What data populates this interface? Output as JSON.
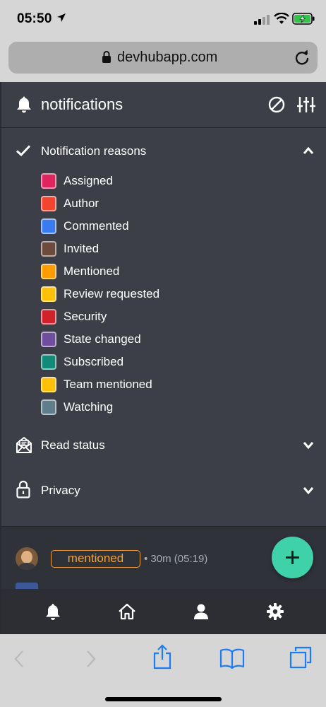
{
  "status_bar": {
    "time": "05:50"
  },
  "browser": {
    "url": "devhubapp.com"
  },
  "header": {
    "title": "notifications"
  },
  "notification_reasons": {
    "title": "Notification reasons",
    "items": [
      {
        "label": "Assigned",
        "color": "#e0245e"
      },
      {
        "label": "Author",
        "color": "#f4442e"
      },
      {
        "label": "Commented",
        "color": "#3b7bf0"
      },
      {
        "label": "Invited",
        "color": "#6d4b3c"
      },
      {
        "label": "Mentioned",
        "color": "#ff9d00"
      },
      {
        "label": "Review requested",
        "color": "#ffc107"
      },
      {
        "label": "Security",
        "color": "#d0222a"
      },
      {
        "label": "State changed",
        "color": "#6f4e9e"
      },
      {
        "label": "Subscribed",
        "color": "#128a7a"
      },
      {
        "label": "Team mentioned",
        "color": "#ffc107"
      },
      {
        "label": "Watching",
        "color": "#607d8b"
      }
    ]
  },
  "read_status": {
    "title": "Read status"
  },
  "privacy": {
    "title": "Privacy"
  },
  "card": {
    "reason_badge": "mentioned",
    "meta": "• 30m (05:19)",
    "badge_color": "#f2a033"
  },
  "fab": {
    "icon": "plus-icon",
    "color": "#3fd1a8"
  },
  "tabbar": {
    "icons": [
      "bell-icon",
      "home-icon",
      "user-icon",
      "gear-icon"
    ]
  }
}
